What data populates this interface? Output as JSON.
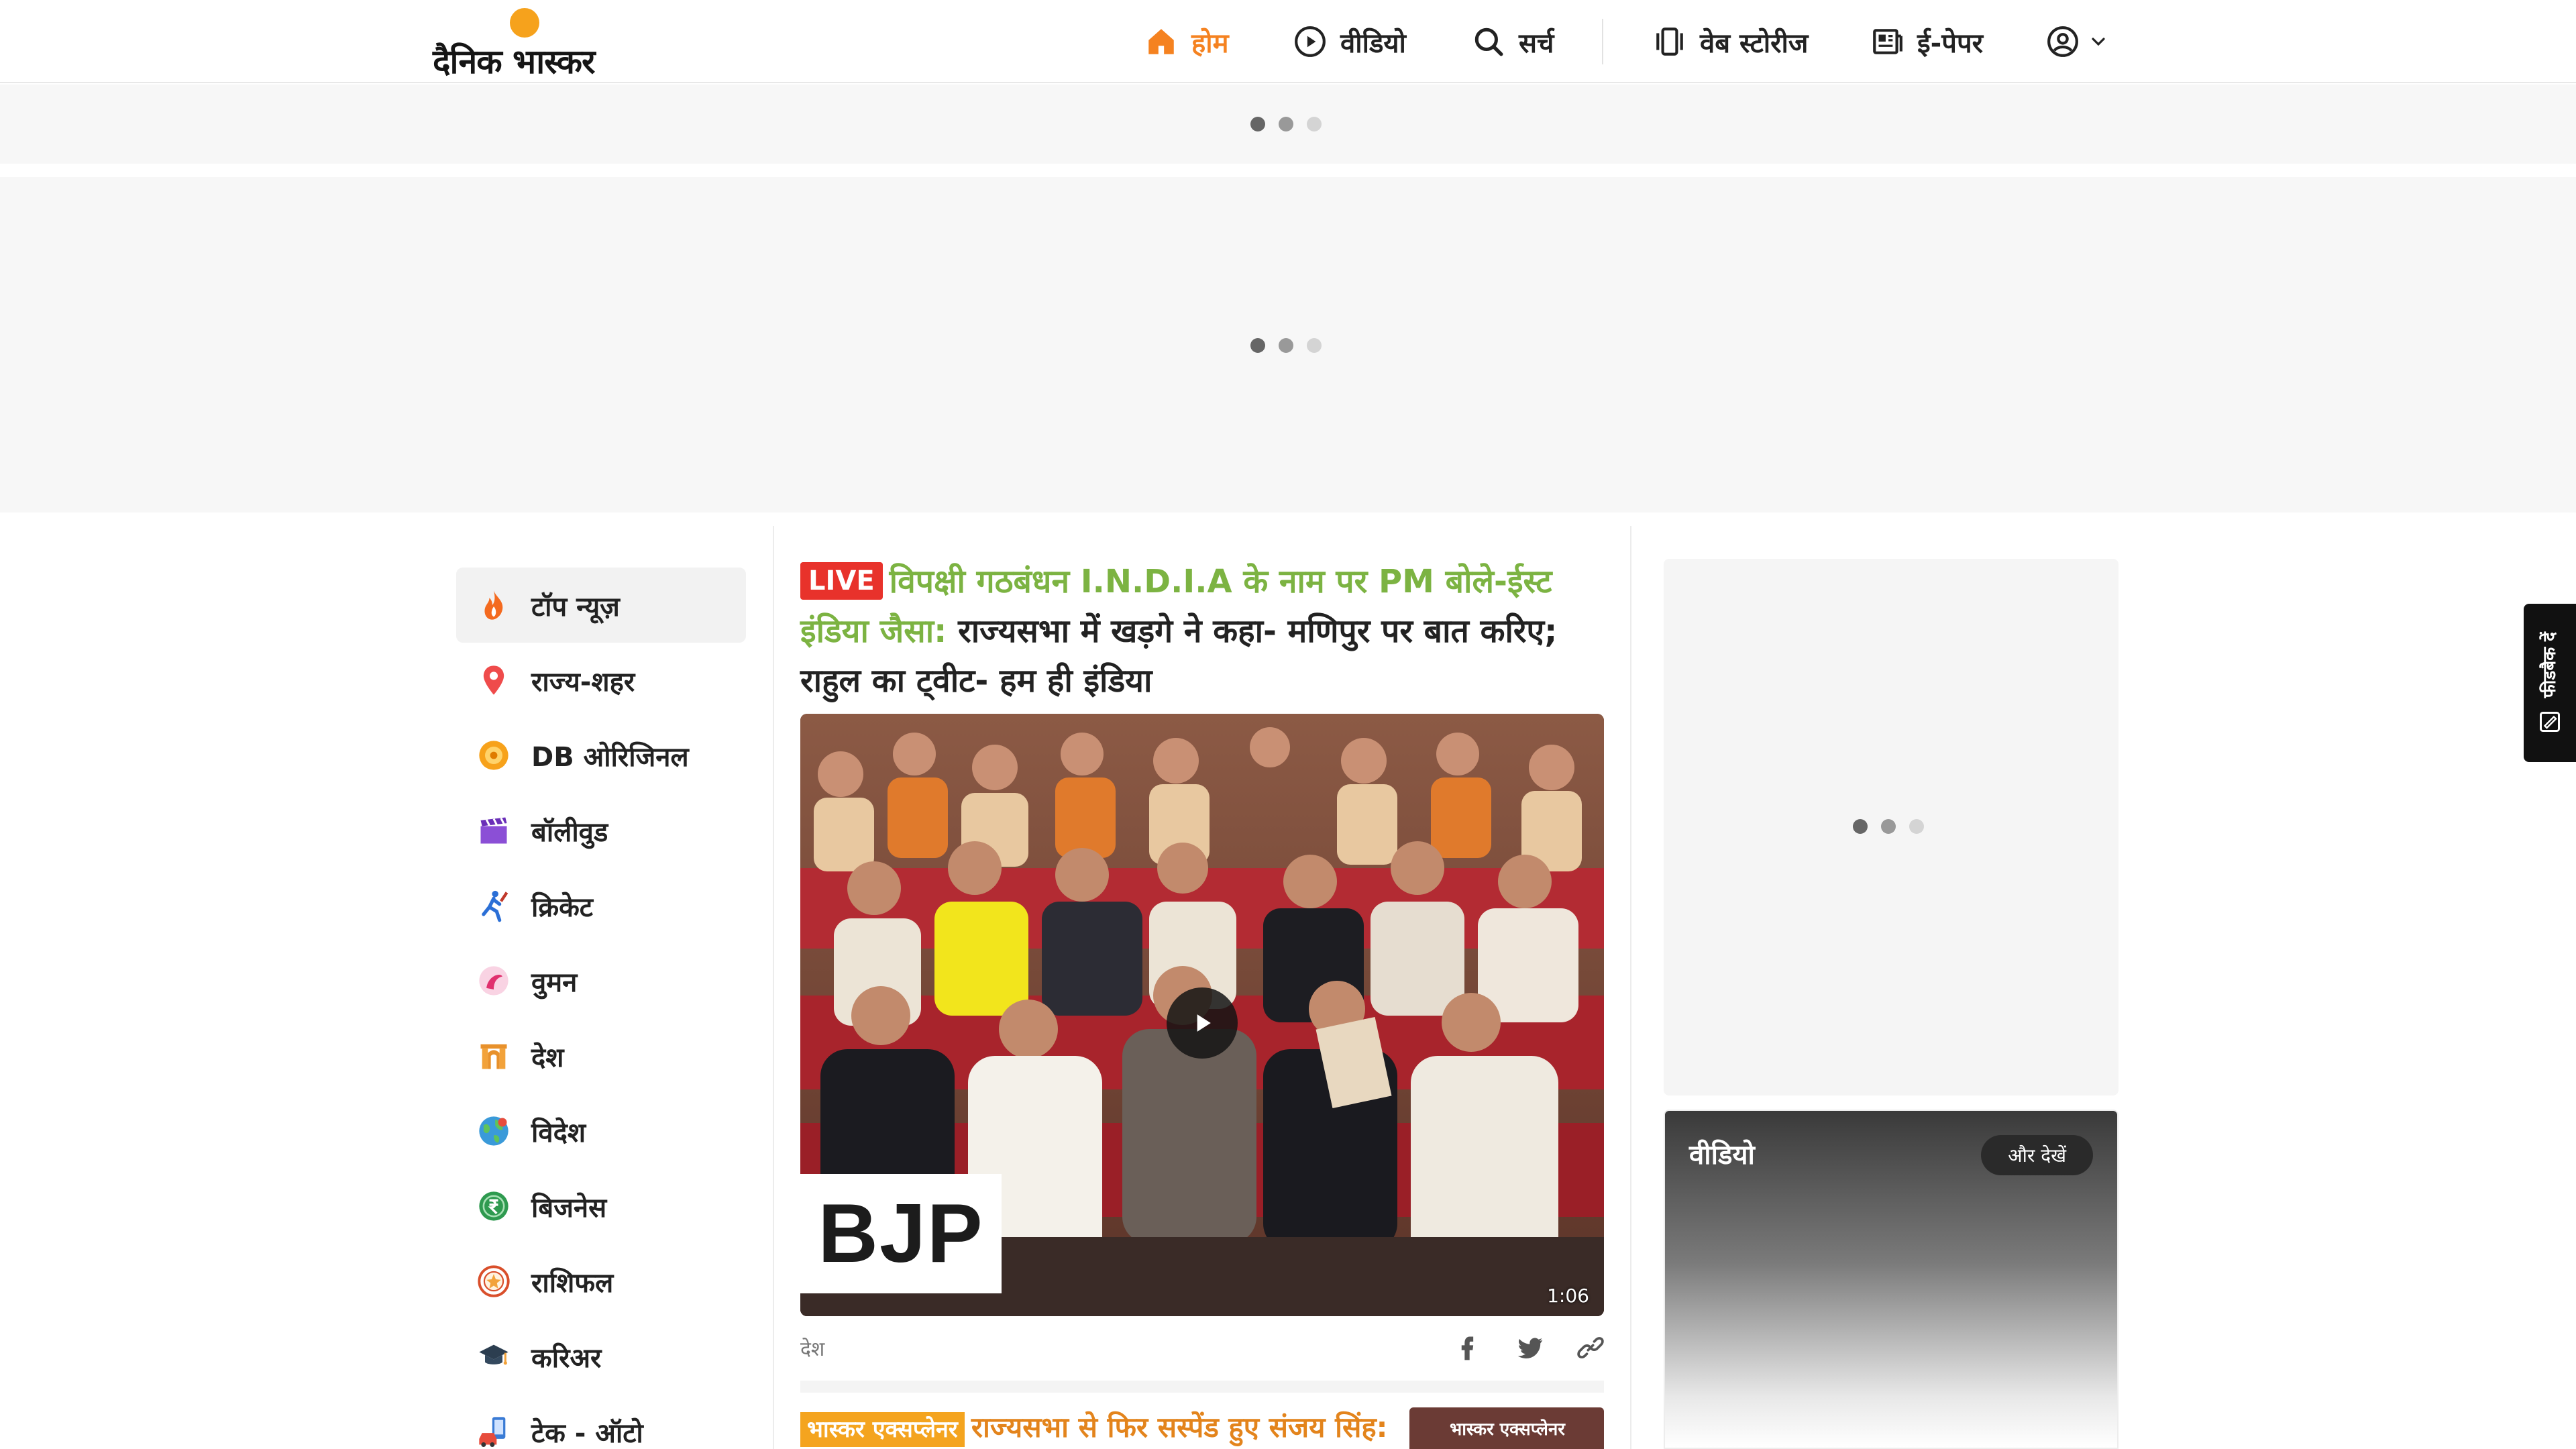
{
  "header": {
    "logo_text": "दैनिक भास्कर",
    "nav": [
      {
        "label": "होम",
        "icon": "home-icon",
        "active": true
      },
      {
        "label": "वीडियो",
        "icon": "play-circle-icon"
      },
      {
        "label": "सर्च",
        "icon": "search-icon"
      },
      {
        "label": "वेब स्टोरीज",
        "icon": "web-stories-icon"
      },
      {
        "label": "ई-पेपर",
        "icon": "newspaper-icon"
      }
    ],
    "account_icon": "user-circle-icon"
  },
  "sidebar": {
    "items": [
      {
        "label": "टॉप न्यूज़",
        "icon": "flame-icon",
        "active": true
      },
      {
        "label": "राज्य-शहर",
        "icon": "location-pin-icon"
      },
      {
        "label": "DB ओरिजिनल",
        "icon": "db-original-icon"
      },
      {
        "label": "बॉलीवुड",
        "icon": "clapperboard-icon"
      },
      {
        "label": "क्रिकेट",
        "icon": "cricket-player-icon"
      },
      {
        "label": "वुमन",
        "icon": "woman-icon"
      },
      {
        "label": "देश",
        "icon": "india-gate-icon"
      },
      {
        "label": "विदेश",
        "icon": "globe-icon"
      },
      {
        "label": "बिजनेस",
        "icon": "rupee-icon"
      },
      {
        "label": "राशिफल",
        "icon": "zodiac-icon"
      },
      {
        "label": "करिअर",
        "icon": "graduation-cap-icon"
      },
      {
        "label": "टेक - ऑटो",
        "icon": "tech-auto-icon"
      }
    ]
  },
  "main": {
    "lead": {
      "badge": "LIVE",
      "headline_highlight": "विपक्षी गठबंधन I.N.D.I.A के नाम पर PM बोले-ईस्ट इंडिया जैसा:",
      "headline_rest": " राज्यसभा में खड़गे ने कहा- मणिपुर पर बात करिए; राहुल का ट्वीट- हम ही इंडिया",
      "video_overlay_text": "BJP",
      "duration": "1:06",
      "category": "देश"
    },
    "second": {
      "badge": "भास्कर एक्सप्लेनर",
      "headline": "राज्यसभा से फिर सस्पेंड हुए संजय सिंह:",
      "thumb_text": "भास्कर एक्सप्लेनर"
    }
  },
  "right": {
    "video_section_title": "वीडियो",
    "more_button": "और देखें"
  },
  "feedback": {
    "label": "फीडबैक दें"
  },
  "colors": {
    "accent": "#f58220",
    "live": "#e8322b",
    "headline_green": "#7cb342",
    "explainer": "#f4a41f"
  }
}
